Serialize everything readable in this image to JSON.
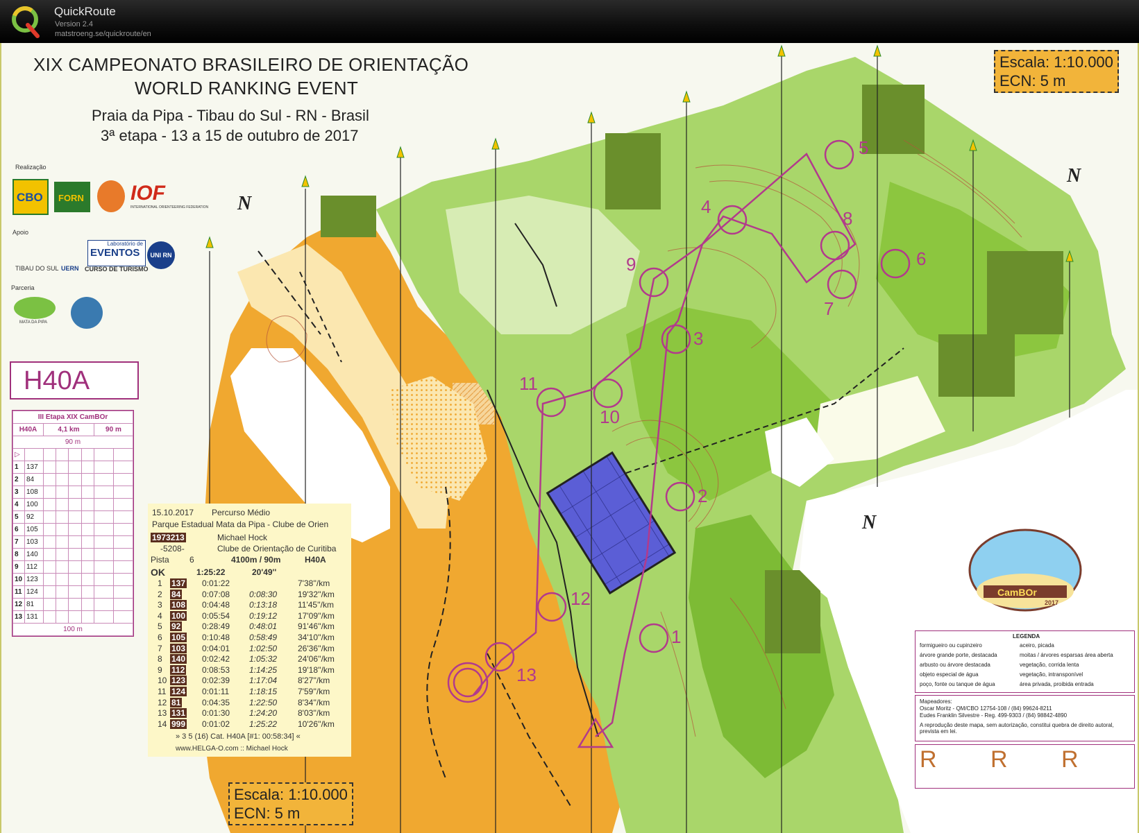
{
  "app": {
    "name": "QuickRoute",
    "version": "Version 2.4",
    "url": "matstroeng.se/quickroute/en"
  },
  "map": {
    "title_line1": "XIX CAMPEONATO BRASILEIRO DE ORIENTAÇÃO",
    "title_line2": "WORLD RANKING EVENT",
    "location": "Praia da Pipa - Tibau do Sul - RN - Brasil",
    "stage": "3ª etapa - 13 a 15 de outubro de 2017",
    "scale": "Escala: 1:10.000",
    "contour": "ECN: 5 m",
    "sponsors": {
      "realizacao": "Realização",
      "apoio": "Apoio",
      "parceria": "Parceria",
      "cbo": "CBO",
      "forn": "FORN",
      "iof": "IOF",
      "iof_caption": "INTERNATIONAL ORIENTEERING FEDERATION",
      "tibau": "TIBAU DO SUL",
      "uern": "UERN",
      "eventos": "EVENTOS",
      "laboratorio": "Laboratório de",
      "turismo": "CURSO DE TURISMO",
      "unirn": "UNI RN",
      "mata": "MATA DA PIPA"
    },
    "north_label": "N",
    "course_name": "H40A",
    "control_labels": [
      "1",
      "2",
      "3",
      "4",
      "5",
      "6",
      "7",
      "8",
      "9",
      "10",
      "11",
      "12",
      "13"
    ],
    "colors": {
      "course": "#b23a8c",
      "open": "#f0a830",
      "forest": "#8cc63f",
      "dark_green": "#6a8f2c",
      "water": "#5b5ed6",
      "frame": "#a0307c"
    }
  },
  "description_sheet": {
    "title": "III Etapa XIX CamBOr",
    "class": "H40A",
    "length": "4,1 km",
    "climb": "90 m",
    "marked": "90 m",
    "finish_dist": "100 m",
    "controls": [
      {
        "n": "1",
        "code": "137"
      },
      {
        "n": "2",
        "code": "84"
      },
      {
        "n": "3",
        "code": "108"
      },
      {
        "n": "4",
        "code": "100"
      },
      {
        "n": "5",
        "code": "92"
      },
      {
        "n": "6",
        "code": "105"
      },
      {
        "n": "7",
        "code": "103"
      },
      {
        "n": "8",
        "code": "140"
      },
      {
        "n": "9",
        "code": "112"
      },
      {
        "n": "10",
        "code": "123"
      },
      {
        "n": "11",
        "code": "124"
      },
      {
        "n": "12",
        "code": "81"
      },
      {
        "n": "13",
        "code": "131"
      }
    ]
  },
  "splits": {
    "date": "15.10.2017",
    "course_type": "Percurso Médio",
    "event": "Parque Estadual Mata da Pipa - Clube de Orien",
    "si_number": "1973213",
    "runner": "Michael Hock",
    "runner_id": "-5208-",
    "club": "Clube de Orientação de Curitiba",
    "pista_label": "Pista",
    "pista": "6",
    "course_len": "4100m / 90m",
    "class": "H40A",
    "status": "OK",
    "total_time": "1:25:22",
    "total_pace": "20'49''",
    "rows": [
      {
        "n": "1",
        "code": "137",
        "split": "0:01:22",
        "cum": "",
        "pace": "7'38''/km"
      },
      {
        "n": "2",
        "code": "84",
        "split": "0:07:08",
        "cum": "0:08:30",
        "pace": "19'32''/km"
      },
      {
        "n": "3",
        "code": "108",
        "split": "0:04:48",
        "cum": "0:13:18",
        "pace": "11'45''/km"
      },
      {
        "n": "4",
        "code": "100",
        "split": "0:05:54",
        "cum": "0:19:12",
        "pace": "17'09''/km"
      },
      {
        "n": "5",
        "code": "92",
        "split": "0:28:49",
        "cum": "0:48:01",
        "pace": "91'46''/km"
      },
      {
        "n": "6",
        "code": "105",
        "split": "0:10:48",
        "cum": "0:58:49",
        "pace": "34'10''/km"
      },
      {
        "n": "7",
        "code": "103",
        "split": "0:04:01",
        "cum": "1:02:50",
        "pace": "26'36''/km"
      },
      {
        "n": "8",
        "code": "140",
        "split": "0:02:42",
        "cum": "1:05:32",
        "pace": "24'06''/km"
      },
      {
        "n": "9",
        "code": "112",
        "split": "0:08:53",
        "cum": "1:14:25",
        "pace": "19'18''/km"
      },
      {
        "n": "10",
        "code": "123",
        "split": "0:02:39",
        "cum": "1:17:04",
        "pace": "8'27''/km"
      },
      {
        "n": "11",
        "code": "124",
        "split": "0:01:11",
        "cum": "1:18:15",
        "pace": "7'59''/km"
      },
      {
        "n": "12",
        "code": "81",
        "split": "0:04:35",
        "cum": "1:22:50",
        "pace": "8'34''/km"
      },
      {
        "n": "13",
        "code": "131",
        "split": "0:01:30",
        "cum": "1:24:20",
        "pace": "8'03''/km"
      },
      {
        "n": "14",
        "code": "999",
        "split": "0:01:02",
        "cum": "1:25:22",
        "pace": "10'26''/km"
      }
    ],
    "footer": "» 3 5 (16) Cat. H40A [#1: 00:58:34] «",
    "footer2": "www.HELGA-O.com :: Michael Hock"
  },
  "legend": {
    "title": "LEGENDA",
    "items_left": [
      "formigueiro ou cupinzeiro",
      "árvore grande porte, destacada",
      "arbusto ou árvore destacada",
      "objeto especial de água",
      "poço, fonte ou tanque de água"
    ],
    "items_right": [
      "aceiro, picada",
      "moitas / árvores esparsas área aberta",
      "vegetação, corrida lenta",
      "vegetação, intransponível",
      "área privada, proibida entrada"
    ]
  },
  "credits": {
    "label": "Mapeadores:",
    "line1": "Oscar Moritz - QM/CBO 12754-108 / (84) 99624-8211",
    "line2": "Eudes Franklin Silvestre - Reg. 499-9303 / (84) 98842-4890",
    "notice": "A reprodução deste mapa, sem autorização, constitui quebra de direito autoral, prevista em lei."
  },
  "reserved": [
    "R",
    "R",
    "R"
  ],
  "event_logo": {
    "text": "CamBOr",
    "year": "2017"
  }
}
